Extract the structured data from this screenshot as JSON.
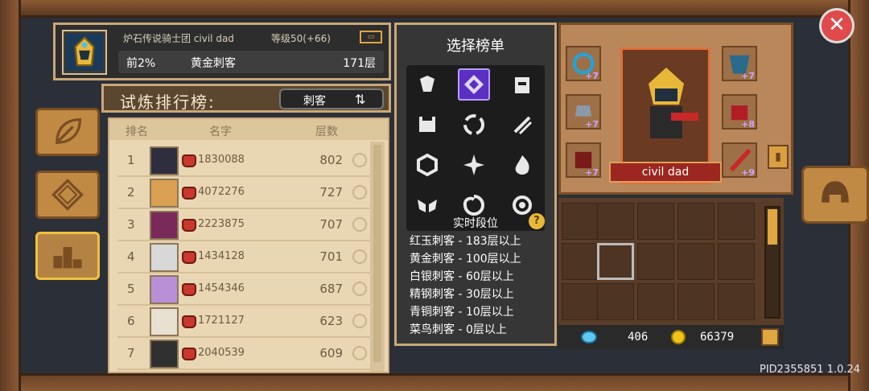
{
  "player": {
    "guild_name": "炉石传说骑士团 civil dad",
    "level": "等级50(+66)",
    "rank_pct": "前2%",
    "rank_title": "黄金刺客",
    "floor": "171层"
  },
  "ranking": {
    "title": "试炼排行榜:",
    "class_label": "刺客",
    "col_rank": "排名",
    "col_name": "名字",
    "col_floors": "层数",
    "rows": [
      {
        "rank": "1",
        "id": "1830088",
        "floors": "802"
      },
      {
        "rank": "2",
        "id": "4072276",
        "floors": "727"
      },
      {
        "rank": "3",
        "id": "2223875",
        "floors": "707"
      },
      {
        "rank": "4",
        "id": "1434128",
        "floors": "701"
      },
      {
        "rank": "5",
        "id": "1454346",
        "floors": "687"
      },
      {
        "rank": "6",
        "id": "1721127",
        "floors": "623"
      },
      {
        "rank": "7",
        "id": "2040539",
        "floors": "609"
      }
    ]
  },
  "selector": {
    "title": "选择榜单",
    "realtime_title": "实时段位",
    "help": "?",
    "tiers": [
      "红玉刺客 - 183层以上",
      "黄金刺客 - 100层以上",
      "白银刺客 - 60层以上",
      "精钢刺客 - 30层以上",
      "青铜刺客 - 10层以上",
      "菜鸟刺客 - 0层以上"
    ]
  },
  "equipment": {
    "hero_name": "civil dad",
    "plus": [
      "+7",
      "+7",
      "+7",
      "+7",
      "+8",
      "+9"
    ],
    "gems": "406",
    "coins": "66379"
  },
  "close": "✕",
  "version": "PID2355851 1.0.24",
  "colors": {
    "accent": "#c9a877",
    "selected_class": "#5a2fc2",
    "close": "#e04a4a"
  }
}
